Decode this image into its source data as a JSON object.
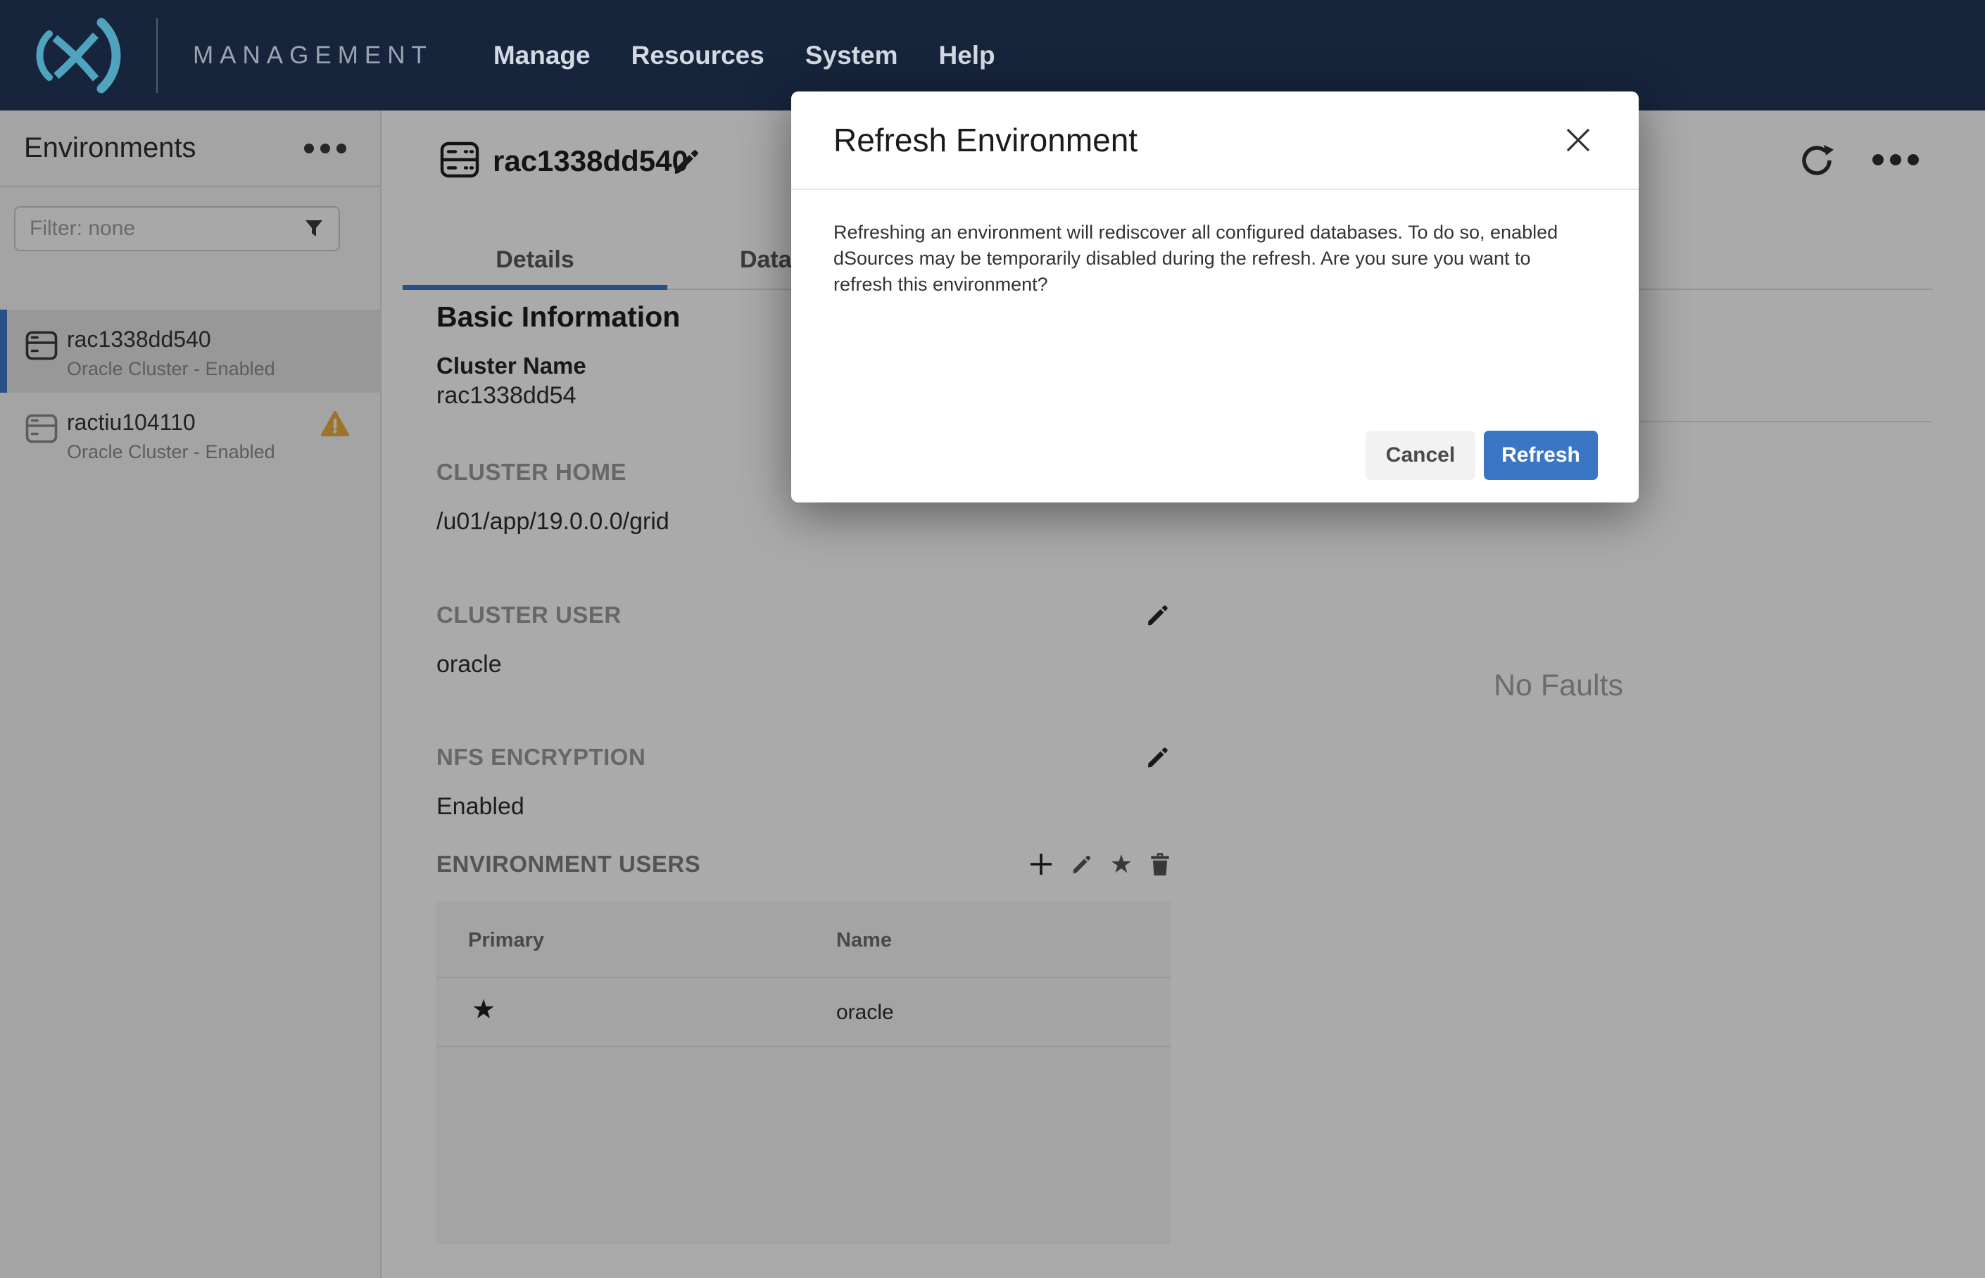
{
  "colors": {
    "navbar_bg": "#16243C",
    "logo_teal": "#4FA3BE",
    "accent_blue": "#3B76C4",
    "warning_orange": "#EFAE3E",
    "overlay": "rgba(0,0,0,0.335)"
  },
  "navbar": {
    "brand": "MANAGEMENT",
    "menu": [
      "Manage",
      "Resources",
      "System",
      "Help"
    ]
  },
  "sidebar": {
    "title": "Environments",
    "filter_placeholder": "Filter: none",
    "items": [
      {
        "name": "rac1338dd540",
        "status": "Oracle Cluster - Enabled",
        "selected": true,
        "warning": false
      },
      {
        "name": "ractiu104110",
        "status": "Oracle Cluster - Enabled",
        "selected": false,
        "warning": true
      }
    ]
  },
  "content": {
    "title": "rac1338dd540",
    "tabs": [
      {
        "label": "Details",
        "active": true
      },
      {
        "label": "Databases",
        "active": false
      }
    ],
    "section_heading": "Basic Information",
    "cluster_name_label": "Cluster Name",
    "cluster_name_value": "rac1338dd54",
    "cluster_home_label": "CLUSTER HOME",
    "cluster_home_value": "/u01/app/19.0.0.0/grid",
    "cluster_user_label": "CLUSTER USER",
    "cluster_user_value": "oracle",
    "nfs_label": "NFS ENCRYPTION",
    "nfs_value": "Enabled",
    "env_users": {
      "heading": "ENVIRONMENT USERS",
      "columns": [
        "Primary",
        "Name"
      ],
      "rows": [
        {
          "primary": "★",
          "name": "oracle"
        }
      ]
    },
    "faults_empty": "No Faults"
  },
  "modal": {
    "title": "Refresh Environment",
    "body_lines": [
      "Refreshing an environment will rediscover all configured databases. To do so, enabled",
      "dSources may be temporarily disabled during the refresh. Are you sure you want to",
      "refresh this environment?"
    ],
    "cancel_label": "Cancel",
    "confirm_label": "Refresh"
  },
  "icons": {
    "star": "★"
  }
}
